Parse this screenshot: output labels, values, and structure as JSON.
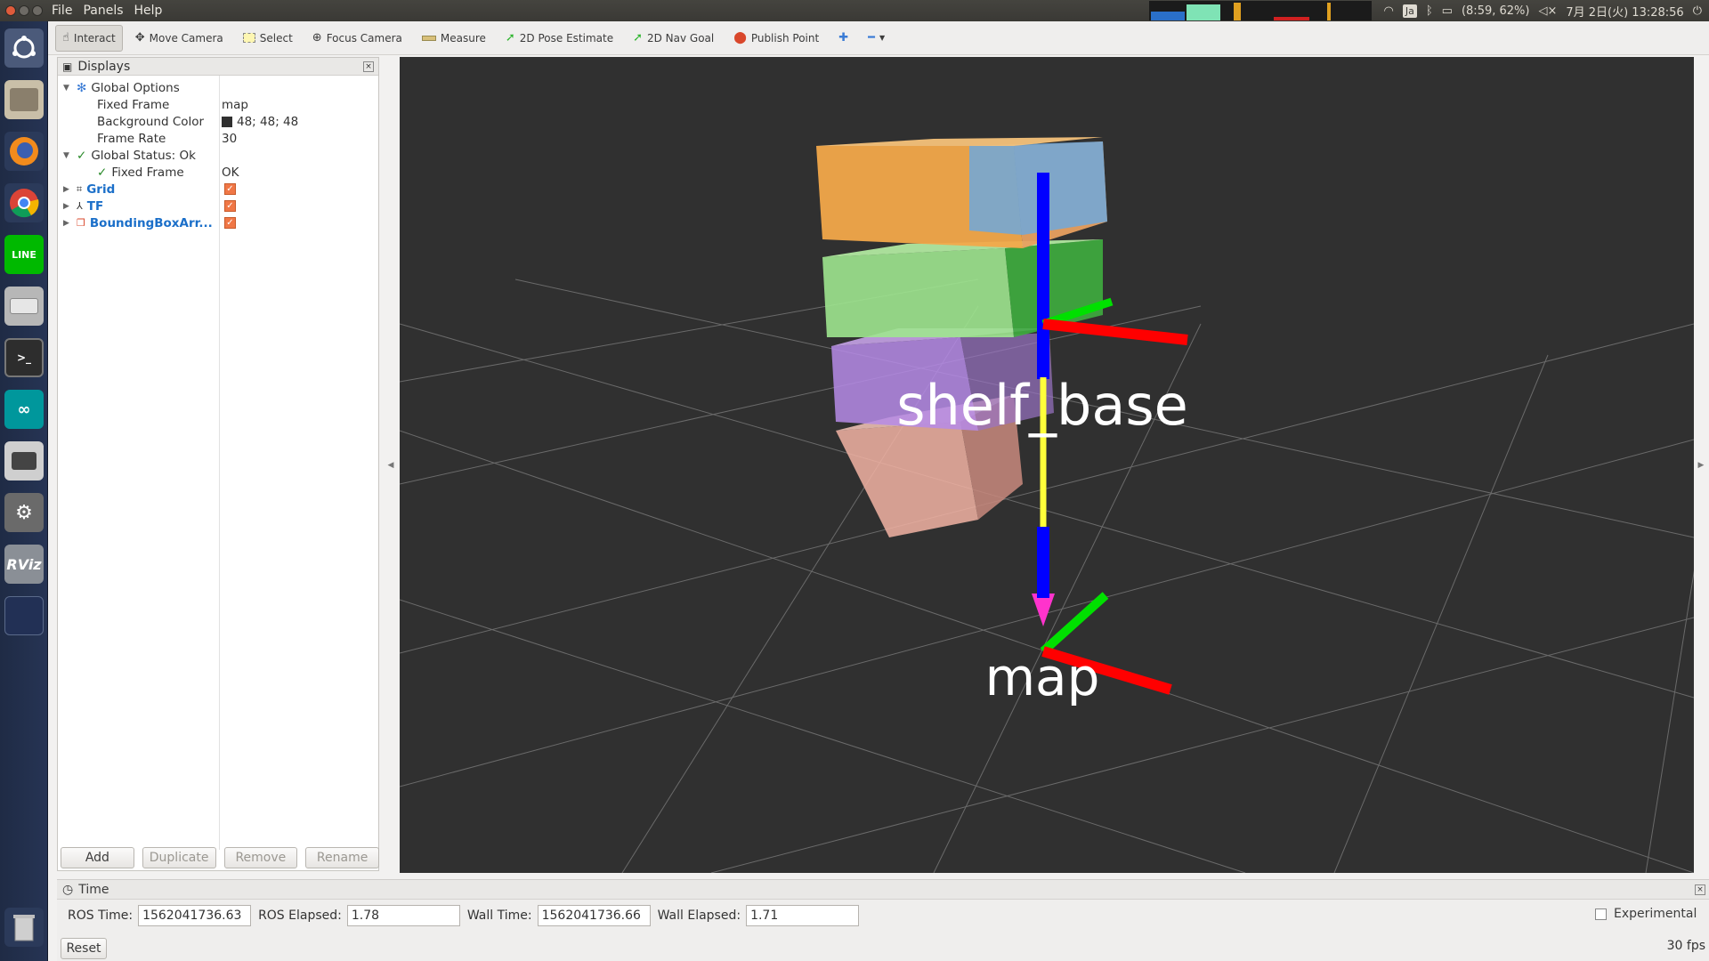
{
  "menubar": {
    "items": [
      "File",
      "Panels",
      "Help"
    ],
    "tray": {
      "battery": "(8:59, 62%)",
      "ime": "Ja",
      "datetime": "7月 2日(火) 13:28:56"
    }
  },
  "toolbar": {
    "tools": [
      {
        "label": "Interact",
        "icon": "hand-icon",
        "active": true
      },
      {
        "label": "Move Camera",
        "icon": "move-camera-icon"
      },
      {
        "label": "Select",
        "icon": "select-icon"
      },
      {
        "label": "Focus Camera",
        "icon": "focus-camera-icon"
      },
      {
        "label": "Measure",
        "icon": "ruler-icon"
      },
      {
        "label": "2D Pose Estimate",
        "icon": "pose-arrow-icon"
      },
      {
        "label": "2D Nav Goal",
        "icon": "nav-goal-arrow-icon"
      },
      {
        "label": "Publish Point",
        "icon": "pin-icon"
      }
    ]
  },
  "displays": {
    "title": "Displays",
    "global_options": "Global Options",
    "fixed_frame_label": "Fixed Frame",
    "fixed_frame_value": "map",
    "background_color_label": "Background Color",
    "background_color_value": "48; 48; 48",
    "background_color_hex": "#303030",
    "frame_rate_label": "Frame Rate",
    "frame_rate_value": "30",
    "global_status": "Global Status: Ok",
    "status_fixed_frame_label": "Fixed Frame",
    "status_fixed_frame_value": "OK",
    "grid": "Grid",
    "tf": "TF",
    "bbox": "BoundingBoxArr...",
    "buttons": {
      "add": "Add",
      "duplicate": "Duplicate",
      "remove": "Remove",
      "rename": "Rename"
    }
  },
  "view3d": {
    "label_shelf": "shelf_base",
    "label_map": "map"
  },
  "time": {
    "title": "Time",
    "ros_time_label": "ROS Time:",
    "ros_time": "1562041736.63",
    "ros_elapsed_label": "ROS Elapsed:",
    "ros_elapsed": "1.78",
    "wall_time_label": "Wall Time:",
    "wall_time": "1562041736.66",
    "wall_elapsed_label": "Wall Elapsed:",
    "wall_elapsed": "1.71",
    "experimental": "Experimental",
    "reset": "Reset",
    "fps": "30 fps"
  },
  "launcher": {
    "apps": [
      "ubuntu-icon",
      "files-icon",
      "firefox-icon",
      "chrome-icon",
      "line-icon",
      "disk-icon",
      "terminal-icon",
      "arduino-icon",
      "camera-icon",
      "settings-icon",
      "rviz-icon",
      "workspace-icon",
      "trash-icon"
    ],
    "line_text": "LINE",
    "rviz_text": "RViz"
  }
}
